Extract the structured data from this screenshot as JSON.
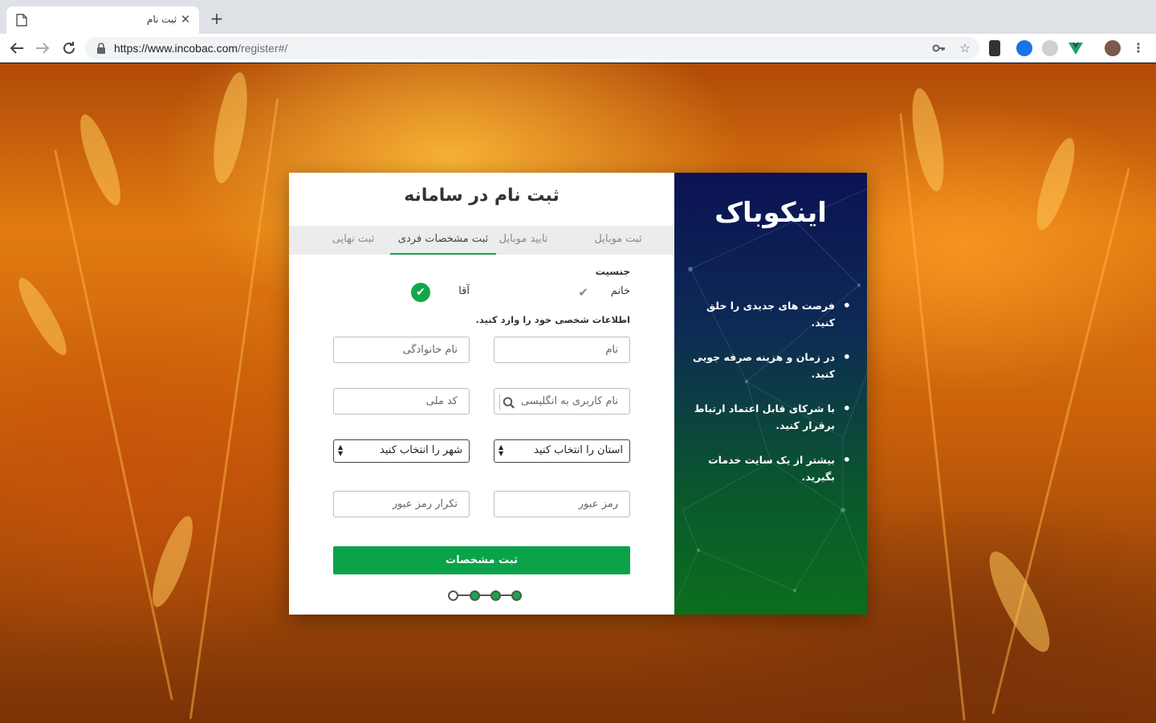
{
  "browser": {
    "tab_title": "ثبت نام",
    "url_host": "https://www.incobac.com",
    "url_path": "/register#/"
  },
  "form": {
    "title": "ثبت نام در سامانه",
    "steps": [
      "ثبت موبایل",
      "تایید موبایل",
      "ثبت مشخصات فردی",
      "ثبت نهایی"
    ],
    "active_step": 2,
    "gender_label": "جنسیت",
    "gender_female": "خانم",
    "gender_male": "آقا",
    "gender_selected": "آقا",
    "info_label": "اطلاعات شخصی خود را وارد کنید.",
    "placeholders": {
      "first_name": "نام",
      "last_name": "نام خانوادگی",
      "username": "نام کاربری به انگلیسی",
      "national_code": "کد ملی",
      "password": "رمز عبور",
      "password_repeat": "تکرار رمز عبور"
    },
    "province_select": "استان را انتخاب کنید",
    "city_select": "شهر را انتخاب کنید",
    "submit_label": "ثبت مشخصات",
    "progress": {
      "total": 4,
      "completed": 3
    }
  },
  "brand": {
    "name": "اینکوباک",
    "features": [
      "فرصت های جدیدی را خلق کنید.",
      "در زمان و هزینه صرفه جویی کنید.",
      "با شرکای قابل اعتماد ارتباط برقرار کنید.",
      "بیشتر از یک سایت خدمات بگیرید."
    ]
  },
  "colors": {
    "accent_green": "#0ba34a",
    "brand_top": "#0c1254",
    "brand_bottom": "#0b6e1c"
  }
}
